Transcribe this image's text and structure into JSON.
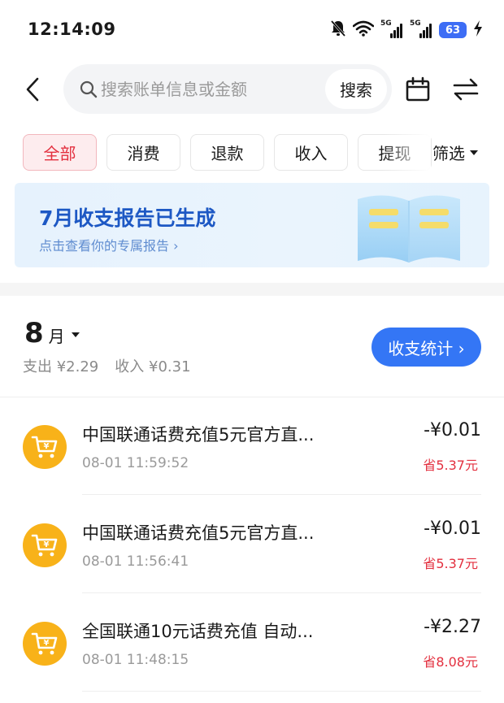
{
  "status_bar": {
    "time": "12:14:09",
    "net1": "5G",
    "net2": "5G",
    "battery": "63"
  },
  "search": {
    "placeholder": "搜索账单信息或金额",
    "button": "搜索"
  },
  "chips": [
    "全部",
    "消费",
    "退款",
    "收入",
    "提现"
  ],
  "filter": {
    "label": "筛选"
  },
  "banner": {
    "title": "7月收支报告已生成",
    "subtitle": "点击查看你的专属报告 ›"
  },
  "month": {
    "number": "8",
    "unit": "月",
    "expense": "支出 ¥2.29",
    "income": "收入 ¥0.31",
    "stats_button": "收支统计 ›"
  },
  "transactions": [
    {
      "name": "中国联通话费充值5元官方直...",
      "time": "08-01 11:59:52",
      "amount": "-¥0.01",
      "saved": "省5.37元"
    },
    {
      "name": "中国联通话费充值5元官方直...",
      "time": "08-01 11:56:41",
      "amount": "-¥0.01",
      "saved": "省5.37元"
    },
    {
      "name": "全国联通10元话费充值 自动...",
      "time": "08-01 11:48:15",
      "amount": "-¥2.27",
      "saved": "省8.08元"
    }
  ],
  "colors": {
    "accent_blue": "#3476f5",
    "accent_red": "#e3303f",
    "avatar_orange": "#f8b219"
  }
}
